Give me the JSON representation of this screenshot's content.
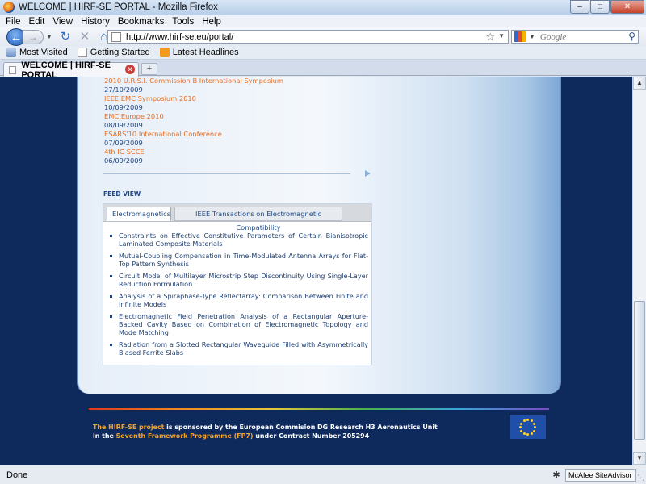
{
  "window": {
    "title": "WELCOME | HIRF-SE PORTAL - Mozilla Firefox"
  },
  "menu": [
    "File",
    "Edit",
    "View",
    "History",
    "Bookmarks",
    "Tools",
    "Help"
  ],
  "nav": {
    "url": "http://www.hirf-se.eu/portal/",
    "search_placeholder": "Google"
  },
  "bookmarks": [
    "Most Visited",
    "Getting Started",
    "Latest Headlines"
  ],
  "tab": {
    "label": "WELCOME | HIRF-SE PORTAL"
  },
  "news": [
    {
      "title": "2010 U.R.S.I. Commission B International Symposium",
      "date": "27/10/2009"
    },
    {
      "title": "IEEE EMC Symposium 2010",
      "date": "10/09/2009"
    },
    {
      "title": "EMC.Europe 2010",
      "date": "08/09/2009"
    },
    {
      "title": "ESARS'10 International Conference",
      "date": "07/09/2009"
    },
    {
      "title": "4th IC-SCCE",
      "date": "06/09/2009"
    }
  ],
  "feed": {
    "title": "FEED VIEW",
    "tabs": [
      "Electromagnetics",
      "IEEE Transactions on Electromagnetic Compatibility"
    ],
    "articles": [
      "Constraints on Effective Constitutive Parameters of Certain Bianisotropic Laminated Composite Materials",
      "Mutual-Coupling Compensation in Time-Modulated Antenna Arrays for Flat-Top Pattern Synthesis",
      "Circuit Model of Multilayer Microstrip Step Discontinuity Using Single-Layer Reduction Formulation",
      "Analysis of a Spiraphase-Type Reflectarray: Comparison Between Finite and Infinite Models",
      "Electromagnetic Field Penetration Analysis of a Rectangular Aperture-Backed Cavity Based on Combination of Electromagnetic Topology and Mode Matching",
      "Radiation from a Slotted Rectangular Waveguide Filled with Asymmetrically Biased Ferrite Slabs"
    ]
  },
  "footer": {
    "project": "The HIRF-SE project",
    "line1_rest": " is sponsored by the European Commision DG Research H3 Aeronautics Unit",
    "line2_pre": "in the ",
    "programme": "Seventh Framework Programme (FP7)",
    "line2_rest": " under Contract Number 205294"
  },
  "status": {
    "text": "Done",
    "addon": "McAfee SiteAdvisor"
  },
  "colors": {
    "page_bg": "#0e2a5c",
    "link_orange": "#e66d22",
    "date_blue": "#234a8a",
    "highlight": "#f2a22c"
  }
}
